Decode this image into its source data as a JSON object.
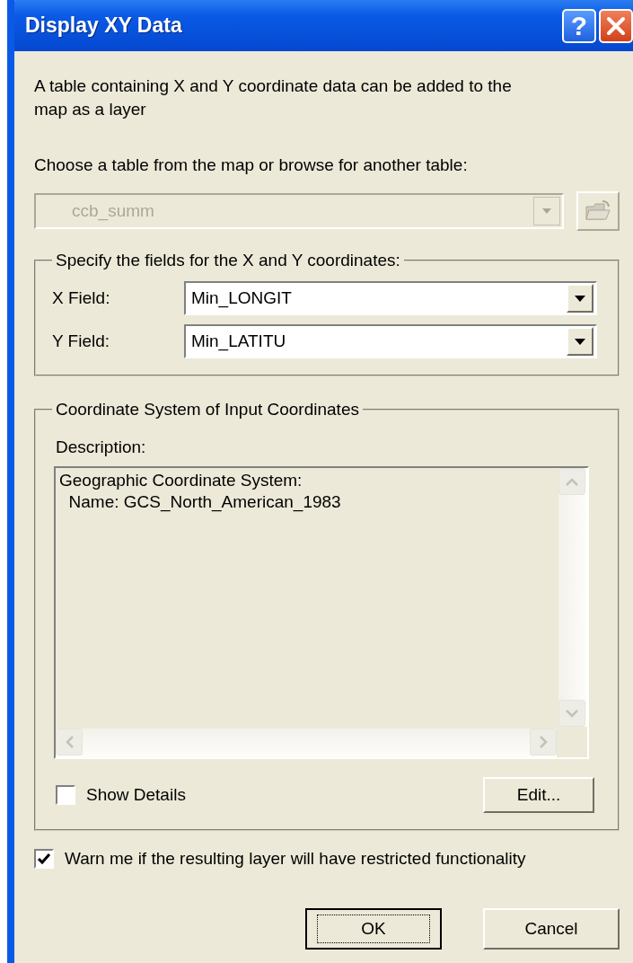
{
  "window": {
    "title": "Display XY Data",
    "help_label": "?"
  },
  "intro": "A table containing X and Y coordinate data can be added to the map as a layer",
  "table_prompt": "Choose a table from the map or browse for another table:",
  "table_combo": {
    "value": "ccb_summ",
    "disabled": true
  },
  "fields_group": {
    "title": "Specify the fields for the X and Y coordinates:",
    "fields": [
      {
        "label": "X Field:",
        "value": "Min_LONGIT"
      },
      {
        "label": "Y Field:",
        "value": "Min_LATITU"
      }
    ]
  },
  "coordinate_group": {
    "title": "Coordinate System of Input Coordinates",
    "description_label": "Description:",
    "description_lines": [
      "Geographic Coordinate System:",
      "  Name: GCS_North_American_1983"
    ],
    "show_details": {
      "label": "Show Details",
      "checked": false
    },
    "edit_button": "Edit..."
  },
  "warn": {
    "label": "Warn me if the resulting layer will have restricted functionality",
    "checked": true
  },
  "buttons": [
    {
      "label": "OK",
      "default": true
    },
    {
      "label": "Cancel",
      "default": false
    }
  ]
}
